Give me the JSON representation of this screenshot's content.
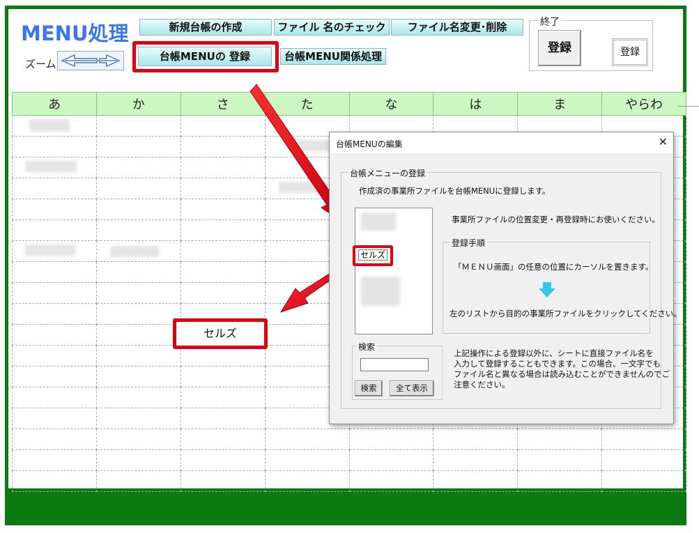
{
  "sheet": {
    "title": "MENU処理",
    "zoom_label": "ズーム",
    "buttons": {
      "new_ledger": "新規台帳の作成",
      "file_check": "ファイル 名のチェック",
      "file_rename": "ファイル名変更･削除",
      "ledger_menu_register": "台帳MENUの 登録",
      "ledger_menu_related": "台帳MENU関係処理"
    },
    "end_group": {
      "legend": "終了",
      "register_big": "登録",
      "register_small": "登録"
    },
    "columns": [
      "あ",
      "か",
      "さ",
      "た",
      "な",
      "は",
      "ま",
      "やらわ"
    ],
    "highlight_cell": "セルズ"
  },
  "dialog": {
    "title": "台帳MENUの編集",
    "close": "✕",
    "register_group": {
      "legend": "台帳メニューの登録",
      "description": "作成済の事業所ファイルを台帳MENUに登録します。"
    },
    "list_selected_item": "セルズ",
    "hint": "事業所ファイルの位置変更・再登録時にお使いください。",
    "procedure": {
      "legend": "登録手順",
      "step1": "「ＭＥＮＵ画面」の任意の位置にカーソルを置きます。",
      "step2": "左のリストから目的の事業所ファイルをクリックしてください。"
    },
    "search": {
      "legend": "検索",
      "value": "",
      "search_button": "検索",
      "show_all_button": "全て表示"
    },
    "note": [
      "上記操作による登録以外に、シートに直接ファイル名を",
      "入力して登録することもできます。この場合、一文字でも",
      "ファイル名と異なる場合は読み込むことができませんのでご",
      "注意ください。"
    ]
  },
  "colors": {
    "frame": "#0b7a10",
    "header_green": "#ccf7c2",
    "highlight_red": "#e00010",
    "title_blue": "#3a78e8",
    "down_arrow": "#33c8e8"
  }
}
